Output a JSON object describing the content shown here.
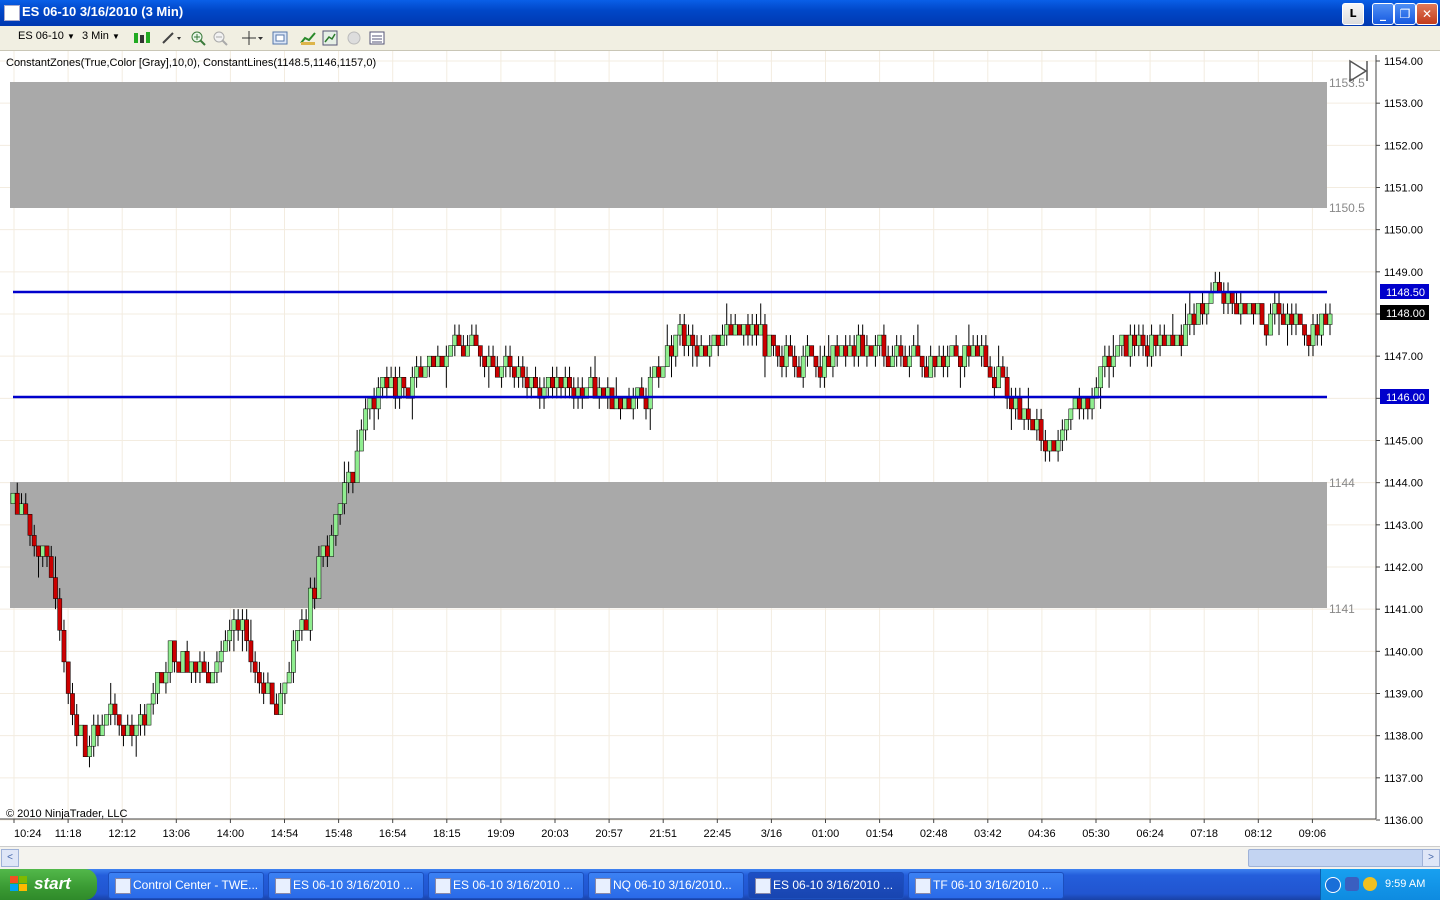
{
  "window": {
    "title": "ES 06-10  3/16/2010 (3 Min)",
    "l_button": "L",
    "minimize": "_",
    "restore": "❐",
    "close": "✕"
  },
  "toolbar": {
    "instrument": "ES 06-10",
    "interval": "3 Min"
  },
  "chart": {
    "indicator_label": "ConstantZones(True,Color [Gray],10,0), ConstantLines(1148.5,1146,1157,0)",
    "copyright": "© 2010 NinjaTrader, LLC",
    "zone_labels": [
      "1153.5",
      "1150.5",
      "1144",
      "1141"
    ],
    "line_labels": [
      "1148.50",
      "1146.00"
    ],
    "last_price_label": "1148.00",
    "colors": {
      "zone": "#a9a9a9",
      "line": "#0000cc",
      "up_bar": "#90ee90",
      "down_bar": "#cc0000",
      "last_price": "#000000"
    }
  },
  "chart_data": {
    "type": "candlestick",
    "interval": "3 Min",
    "y_axis": {
      "range": [
        1136,
        1154
      ],
      "ticks": [
        "1154.00",
        "1153.00",
        "1152.00",
        "1151.00",
        "1150.00",
        "1149.00",
        "1148.00",
        "1147.00",
        "1146.00",
        "1145.00",
        "1144.00",
        "1143.00",
        "1142.00",
        "1141.00",
        "1140.00",
        "1139.00",
        "1138.00",
        "1137.00",
        "1136.00"
      ]
    },
    "x_axis": {
      "ticks": [
        "10:24",
        "11:18",
        "12:12",
        "13:06",
        "14:00",
        "14:54",
        "15:48",
        "16:54",
        "18:15",
        "19:09",
        "20:03",
        "20:57",
        "21:51",
        "22:45",
        "3/16",
        "01:00",
        "01:54",
        "02:48",
        "03:42",
        "04:36",
        "05:30",
        "06:24",
        "07:18",
        "08:12",
        "09:06"
      ]
    },
    "zones": [
      {
        "from": 1150.5,
        "to": 1153.5
      },
      {
        "from": 1141,
        "to": 1144
      }
    ],
    "lines": [
      1148.5,
      1146
    ],
    "last_price": 1148.0,
    "price_path": [
      [
        0,
        1143.5
      ],
      [
        6,
        1142.5
      ],
      [
        10,
        1141.5
      ],
      [
        13,
        1139.0
      ],
      [
        17,
        1137.5
      ],
      [
        22,
        1138.5
      ],
      [
        28,
        1138.0
      ],
      [
        33,
        1139.0
      ],
      [
        37,
        1140.0
      ],
      [
        45,
        1139.5
      ],
      [
        53,
        1140.5
      ],
      [
        58,
        1139.5
      ],
      [
        62,
        1138.5
      ],
      [
        66,
        1140.0
      ],
      [
        73,
        1142.5
      ],
      [
        79,
        1144.0
      ],
      [
        84,
        1146.0
      ],
      [
        95,
        1146.5
      ],
      [
        100,
        1147.0
      ],
      [
        108,
        1147.2
      ],
      [
        120,
        1146.5
      ],
      [
        135,
        1146.2
      ],
      [
        148,
        1146.0
      ],
      [
        155,
        1147.3
      ],
      [
        168,
        1147.5
      ],
      [
        185,
        1147.0
      ],
      [
        200,
        1147.2
      ],
      [
        215,
        1146.8
      ],
      [
        222,
        1147.3
      ],
      [
        232,
        1146.6
      ],
      [
        240,
        1145.3
      ],
      [
        246,
        1144.8
      ],
      [
        252,
        1146.0
      ],
      [
        260,
        1147.2
      ],
      [
        275,
        1147.5
      ],
      [
        283,
        1148.5
      ],
      [
        290,
        1148.1
      ],
      [
        305,
        1147.7
      ],
      [
        310,
        1148.0
      ]
    ]
  },
  "scrollbar": {
    "left_arrow": "<",
    "right_arrow": ">"
  },
  "taskbar": {
    "start": "start",
    "items": [
      "Control Center - TWE...",
      "ES 06-10  3/16/2010 ...",
      "ES 06-10  3/16/2010 ...",
      "NQ 06-10  3/16/2010...",
      "ES 06-10  3/16/2010 ...",
      "TF 06-10  3/16/2010 ..."
    ],
    "clock": "9:59 AM"
  }
}
